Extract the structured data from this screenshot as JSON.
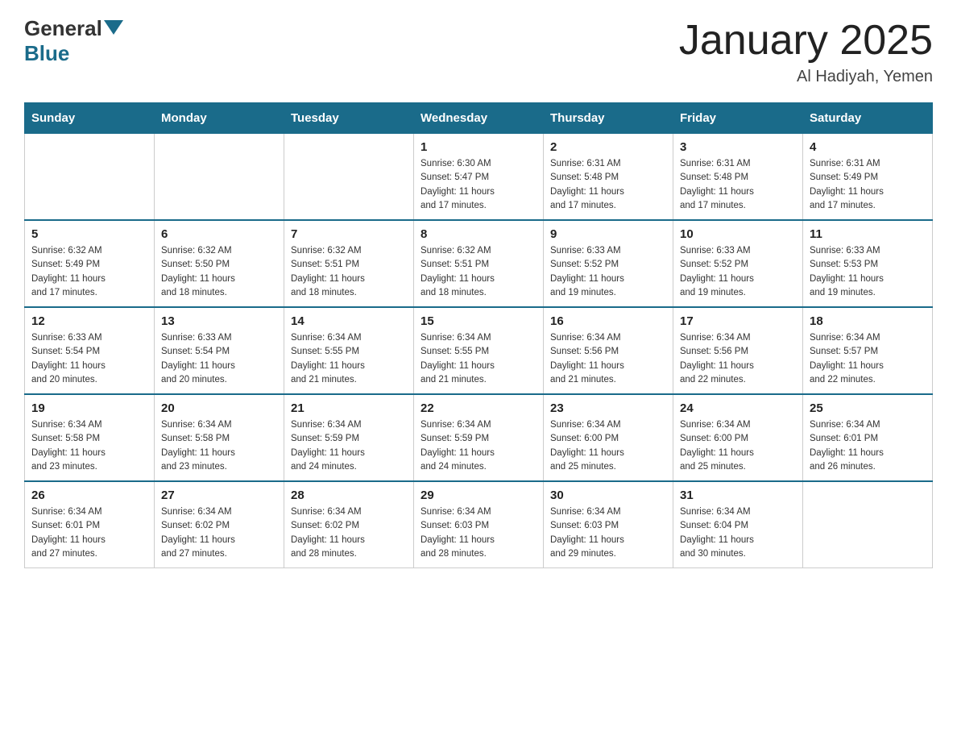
{
  "logo": {
    "general": "General",
    "blue": "Blue"
  },
  "title": "January 2025",
  "location": "Al Hadiyah, Yemen",
  "days_of_week": [
    "Sunday",
    "Monday",
    "Tuesday",
    "Wednesday",
    "Thursday",
    "Friday",
    "Saturday"
  ],
  "weeks": [
    [
      {
        "day": "",
        "info": ""
      },
      {
        "day": "",
        "info": ""
      },
      {
        "day": "",
        "info": ""
      },
      {
        "day": "1",
        "info": "Sunrise: 6:30 AM\nSunset: 5:47 PM\nDaylight: 11 hours\nand 17 minutes."
      },
      {
        "day": "2",
        "info": "Sunrise: 6:31 AM\nSunset: 5:48 PM\nDaylight: 11 hours\nand 17 minutes."
      },
      {
        "day": "3",
        "info": "Sunrise: 6:31 AM\nSunset: 5:48 PM\nDaylight: 11 hours\nand 17 minutes."
      },
      {
        "day": "4",
        "info": "Sunrise: 6:31 AM\nSunset: 5:49 PM\nDaylight: 11 hours\nand 17 minutes."
      }
    ],
    [
      {
        "day": "5",
        "info": "Sunrise: 6:32 AM\nSunset: 5:49 PM\nDaylight: 11 hours\nand 17 minutes."
      },
      {
        "day": "6",
        "info": "Sunrise: 6:32 AM\nSunset: 5:50 PM\nDaylight: 11 hours\nand 18 minutes."
      },
      {
        "day": "7",
        "info": "Sunrise: 6:32 AM\nSunset: 5:51 PM\nDaylight: 11 hours\nand 18 minutes."
      },
      {
        "day": "8",
        "info": "Sunrise: 6:32 AM\nSunset: 5:51 PM\nDaylight: 11 hours\nand 18 minutes."
      },
      {
        "day": "9",
        "info": "Sunrise: 6:33 AM\nSunset: 5:52 PM\nDaylight: 11 hours\nand 19 minutes."
      },
      {
        "day": "10",
        "info": "Sunrise: 6:33 AM\nSunset: 5:52 PM\nDaylight: 11 hours\nand 19 minutes."
      },
      {
        "day": "11",
        "info": "Sunrise: 6:33 AM\nSunset: 5:53 PM\nDaylight: 11 hours\nand 19 minutes."
      }
    ],
    [
      {
        "day": "12",
        "info": "Sunrise: 6:33 AM\nSunset: 5:54 PM\nDaylight: 11 hours\nand 20 minutes."
      },
      {
        "day": "13",
        "info": "Sunrise: 6:33 AM\nSunset: 5:54 PM\nDaylight: 11 hours\nand 20 minutes."
      },
      {
        "day": "14",
        "info": "Sunrise: 6:34 AM\nSunset: 5:55 PM\nDaylight: 11 hours\nand 21 minutes."
      },
      {
        "day": "15",
        "info": "Sunrise: 6:34 AM\nSunset: 5:55 PM\nDaylight: 11 hours\nand 21 minutes."
      },
      {
        "day": "16",
        "info": "Sunrise: 6:34 AM\nSunset: 5:56 PM\nDaylight: 11 hours\nand 21 minutes."
      },
      {
        "day": "17",
        "info": "Sunrise: 6:34 AM\nSunset: 5:56 PM\nDaylight: 11 hours\nand 22 minutes."
      },
      {
        "day": "18",
        "info": "Sunrise: 6:34 AM\nSunset: 5:57 PM\nDaylight: 11 hours\nand 22 minutes."
      }
    ],
    [
      {
        "day": "19",
        "info": "Sunrise: 6:34 AM\nSunset: 5:58 PM\nDaylight: 11 hours\nand 23 minutes."
      },
      {
        "day": "20",
        "info": "Sunrise: 6:34 AM\nSunset: 5:58 PM\nDaylight: 11 hours\nand 23 minutes."
      },
      {
        "day": "21",
        "info": "Sunrise: 6:34 AM\nSunset: 5:59 PM\nDaylight: 11 hours\nand 24 minutes."
      },
      {
        "day": "22",
        "info": "Sunrise: 6:34 AM\nSunset: 5:59 PM\nDaylight: 11 hours\nand 24 minutes."
      },
      {
        "day": "23",
        "info": "Sunrise: 6:34 AM\nSunset: 6:00 PM\nDaylight: 11 hours\nand 25 minutes."
      },
      {
        "day": "24",
        "info": "Sunrise: 6:34 AM\nSunset: 6:00 PM\nDaylight: 11 hours\nand 25 minutes."
      },
      {
        "day": "25",
        "info": "Sunrise: 6:34 AM\nSunset: 6:01 PM\nDaylight: 11 hours\nand 26 minutes."
      }
    ],
    [
      {
        "day": "26",
        "info": "Sunrise: 6:34 AM\nSunset: 6:01 PM\nDaylight: 11 hours\nand 27 minutes."
      },
      {
        "day": "27",
        "info": "Sunrise: 6:34 AM\nSunset: 6:02 PM\nDaylight: 11 hours\nand 27 minutes."
      },
      {
        "day": "28",
        "info": "Sunrise: 6:34 AM\nSunset: 6:02 PM\nDaylight: 11 hours\nand 28 minutes."
      },
      {
        "day": "29",
        "info": "Sunrise: 6:34 AM\nSunset: 6:03 PM\nDaylight: 11 hours\nand 28 minutes."
      },
      {
        "day": "30",
        "info": "Sunrise: 6:34 AM\nSunset: 6:03 PM\nDaylight: 11 hours\nand 29 minutes."
      },
      {
        "day": "31",
        "info": "Sunrise: 6:34 AM\nSunset: 6:04 PM\nDaylight: 11 hours\nand 30 minutes."
      },
      {
        "day": "",
        "info": ""
      }
    ]
  ]
}
